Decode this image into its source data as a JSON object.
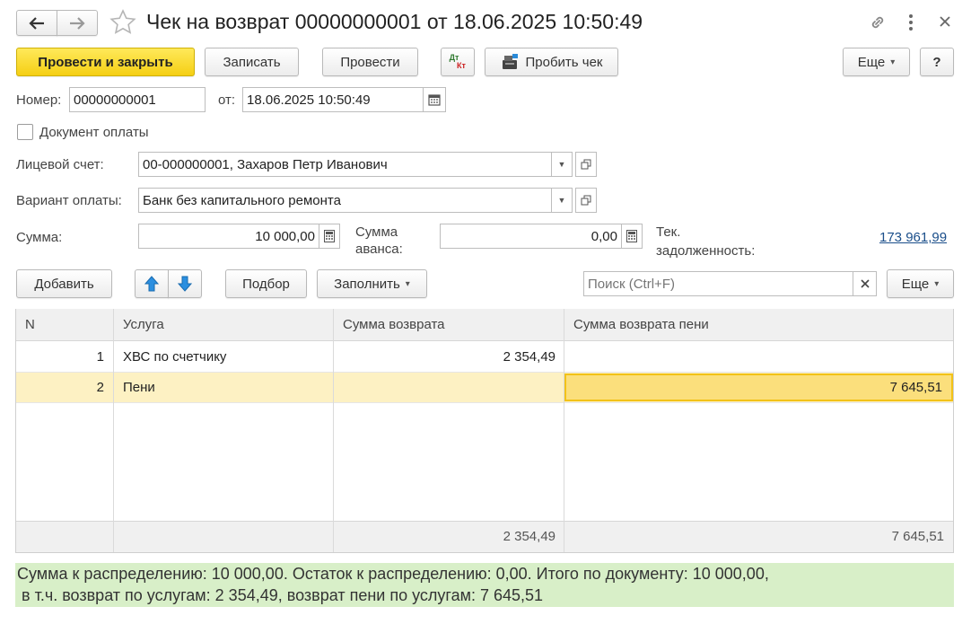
{
  "window": {
    "title": "Чек на возврат 00000000001 от 18.06.2025 10:50:49",
    "link_icon": "link-icon",
    "more_icon": "more-vertical-icon",
    "close_icon": "close-icon"
  },
  "toolbar": {
    "post_close": "Провести и закрыть",
    "save": "Записать",
    "post": "Провести",
    "dtkt_top": "Дт",
    "dtkt_bottom": "Кт",
    "print_receipt": "Пробить чек",
    "more": "Еще",
    "help": "?"
  },
  "header": {
    "number_label": "Номер:",
    "number_value": "00000000001",
    "date_label": "от:",
    "date_value": "18.06.2025 10:50:49",
    "payment_doc_label": "Документ оплаты",
    "account_label": "Лицевой счет:",
    "account_value": "00-000000001, Захаров Петр Иванович",
    "payment_variant_label": "Вариант оплаты:",
    "payment_variant_value": "Банк без капитального ремонта",
    "sum_label": "Сумма:",
    "sum_value": "10 000,00",
    "advance_label_1": "Сумма",
    "advance_label_2": "аванса:",
    "advance_value": "0,00",
    "debt_label_1": "Тек.",
    "debt_label_2": "задолженность:",
    "debt_value": "173 961,99"
  },
  "table_toolbar": {
    "add": "Добавить",
    "selection": "Подбор",
    "fill": "Заполнить",
    "search_placeholder": "Поиск (Ctrl+F)",
    "more": "Еще"
  },
  "table": {
    "columns": [
      "N",
      "Услуга",
      "Сумма возврата",
      "Сумма возврата пени"
    ],
    "rows": [
      {
        "n": "1",
        "service": "ХВС по счетчику",
        "refund": "2 354,49",
        "penalty": ""
      },
      {
        "n": "2",
        "service": "Пени",
        "refund": "",
        "penalty": "7 645,51"
      }
    ],
    "totals": {
      "refund": "2 354,49",
      "penalty": "7 645,51"
    }
  },
  "summary": {
    "line1": "Сумма к распределению: 10 000,00. Остаток к распределению: 0,00. Итого по документу: 10 000,00,",
    "line2": " в т.ч. возврат по услугам: 2 354,49, возврат пени по услугам: 7 645,51"
  },
  "colors": {
    "accent": "#f5cf14",
    "link": "#1a4e8a",
    "selected_row": "#fdf1c3",
    "summary_bg": "#d8efc8"
  }
}
